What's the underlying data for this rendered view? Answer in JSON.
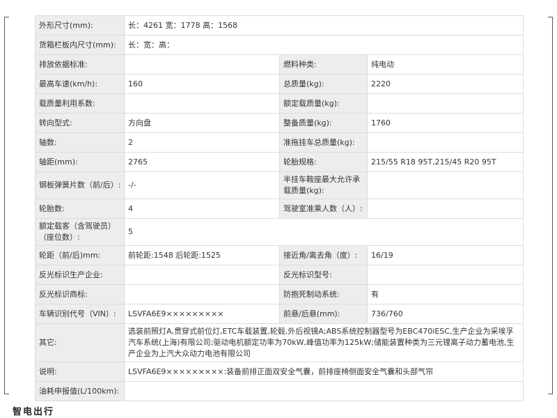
{
  "rows": [
    {
      "l1": "外形尺寸(mm):",
      "v1": "长：4261 宽：1778 高：1568"
    },
    {
      "l1": "货箱栏板内尺寸(mm):",
      "v1": "长：宽：高："
    },
    {
      "l1": "排放依据标准:",
      "v1": "",
      "l2": "燃料种类:",
      "v2": "纯电动"
    },
    {
      "l1": "最高车速(km/h):",
      "v1": "160",
      "l2": "总质量(kg):",
      "v2": "2220"
    },
    {
      "l1": "载质量利用系数:",
      "v1": "",
      "l2": "额定载质量(kg):",
      "v2": ""
    },
    {
      "l1": "转向型式:",
      "v1": "方向盘",
      "l2": "整备质量(kg):",
      "v2": "1760"
    },
    {
      "l1": "轴数:",
      "v1": "2",
      "l2": "准拖挂车总质量(kg):",
      "v2": ""
    },
    {
      "l1": "轴距(mm):",
      "v1": "2765",
      "l2": "轮胎规格:",
      "v2": "215/55 R18 95T,215/45 R20 95T"
    },
    {
      "l1": "钢板弹簧片数（前/后）:",
      "v1": "-/-",
      "l2": "半挂车鞍座最大允许承载质量(kg):",
      "v2": ""
    },
    {
      "l1": "轮胎数:",
      "v1": "4",
      "l2": "驾驶室准乘人数（人）:",
      "v2": ""
    },
    {
      "l1": "额定载客（含驾驶员）（座位数）:",
      "v1": "5"
    },
    {
      "l1": "轮距（前/后)mm:",
      "v1": "前轮距:1548 后轮距:1525",
      "l2": "接近角/离去角（度）:",
      "v2": "16/19"
    },
    {
      "l1": "反光标识生产企业:",
      "v1": "",
      "l2": "反光标识型号:",
      "v2": ""
    },
    {
      "l1": "反光标识商标:",
      "v1": "",
      "l2": "防抱死制动系统:",
      "v2": "有"
    },
    {
      "l1": "车辆识别代号（VIN）:",
      "v1": "LSVFA6E9×××××××××",
      "l2": "前悬/后悬(mm):",
      "v2": "736/760"
    },
    {
      "l1": "其它:",
      "v1": "选装前照灯A,贯穿式前位灯,ETC车载装置,轮毂,外后视镜A;ABS系统控制器型号为EBC470iESC,生产企业为采埃孚汽车系统(上海)有限公司;驱动电机额定功率为70kW,峰值功率为125kW;储能装置种类为三元锂离子动力蓄电池,生产企业为上汽大众动力电池有限公司"
    },
    {
      "l1": "说明:",
      "v1": "LSVFA6E9×××××××××:装备前排正面双安全气囊，前排座椅侧面安全气囊和头部气帘"
    },
    {
      "l1": "油耗申报值(L/100km):",
      "v1": ""
    }
  ],
  "watermark": "智电出行"
}
